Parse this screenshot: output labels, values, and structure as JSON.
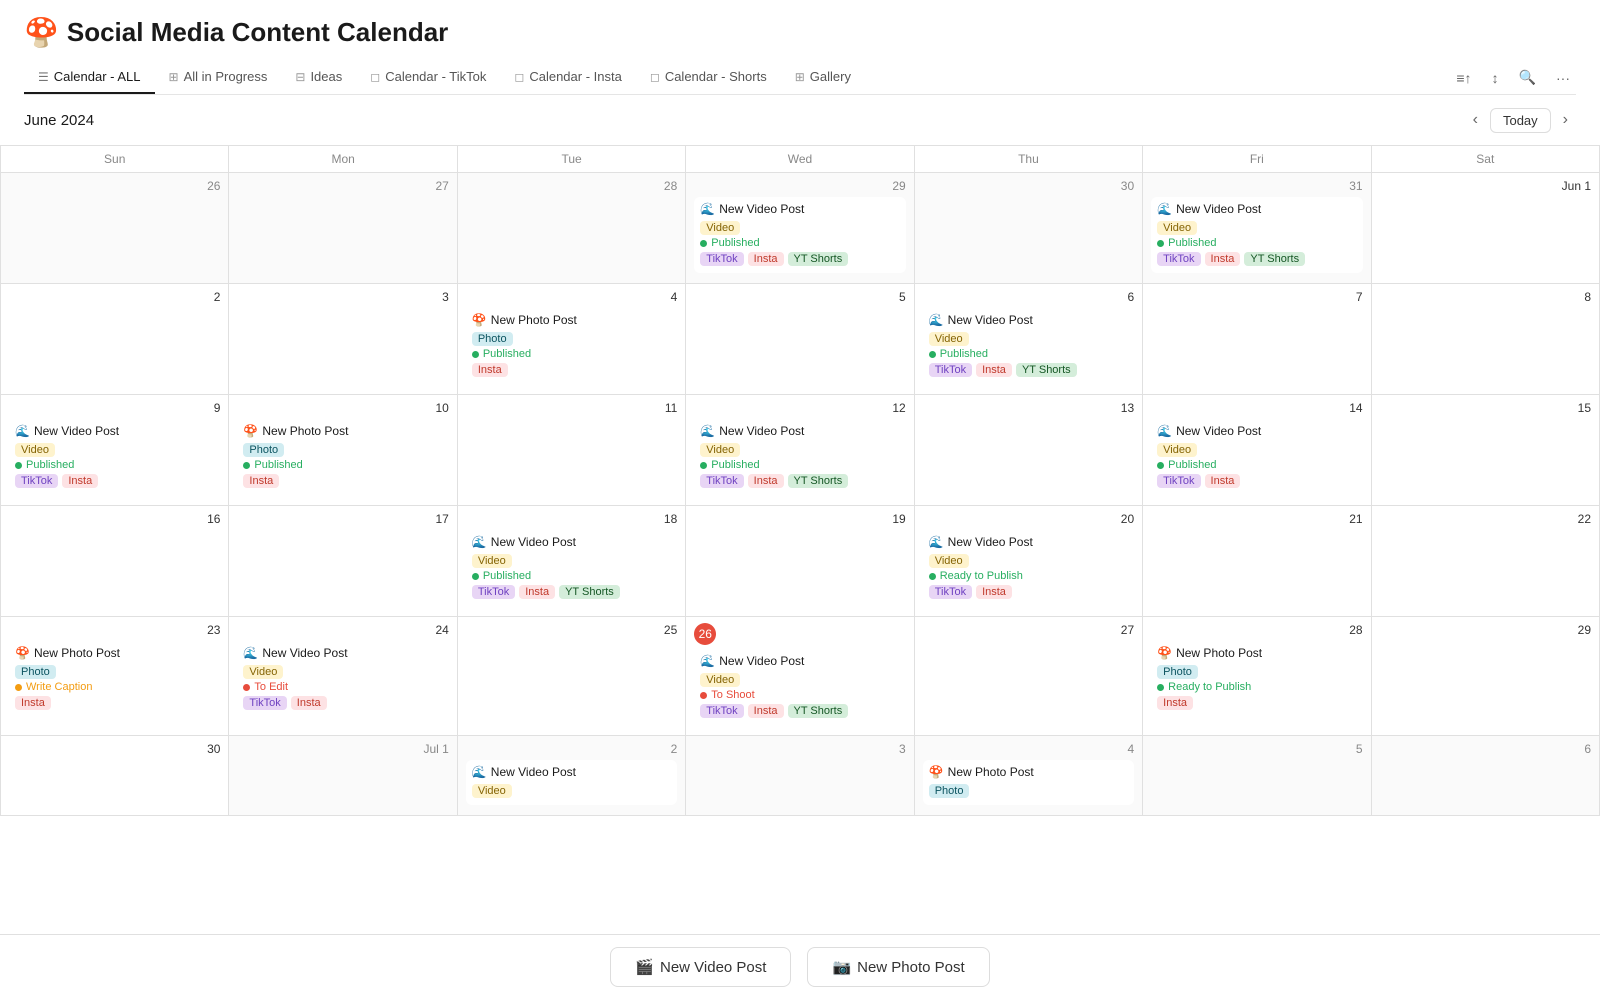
{
  "app": {
    "title": "Social Media Content Calendar",
    "emoji": "🍄"
  },
  "nav": {
    "tabs": [
      {
        "id": "calendar-all",
        "label": "Calendar - ALL",
        "icon": "☰",
        "active": true
      },
      {
        "id": "all-in-progress",
        "label": "All in Progress",
        "icon": "⊞",
        "active": false
      },
      {
        "id": "ideas",
        "label": "Ideas",
        "icon": "⊟",
        "active": false
      },
      {
        "id": "calendar-tiktok",
        "label": "Calendar - TikTok",
        "icon": "◻",
        "active": false
      },
      {
        "id": "calendar-insta",
        "label": "Calendar - Insta",
        "icon": "◻",
        "active": false
      },
      {
        "id": "calendar-shorts",
        "label": "Calendar - Shorts",
        "icon": "◻",
        "active": false
      },
      {
        "id": "gallery",
        "label": "Gallery",
        "icon": "⊞",
        "active": false
      }
    ]
  },
  "calendar": {
    "month": "June 2024",
    "today_label": "Today",
    "day_headers": [
      "Sun",
      "Mon",
      "Tue",
      "Wed",
      "Thu",
      "Fri",
      "Sat"
    ],
    "weeks": [
      {
        "days": [
          {
            "date": 26,
            "current": false,
            "today": false,
            "events": []
          },
          {
            "date": 27,
            "current": false,
            "today": false,
            "events": []
          },
          {
            "date": 28,
            "current": false,
            "today": false,
            "events": []
          },
          {
            "date": 29,
            "current": false,
            "today": false,
            "events": [
              {
                "title": "New Video Post",
                "emoji": "🌊",
                "type": "Video",
                "type_tag": "video",
                "status": "Published",
                "status_key": "published",
                "platforms": [
                  "TikTok",
                  "Insta",
                  "YT Shorts"
                ]
              }
            ]
          },
          {
            "date": 30,
            "current": false,
            "today": false,
            "events": []
          },
          {
            "date": 31,
            "current": false,
            "today": false,
            "events": [
              {
                "title": "New Video Post",
                "emoji": "🌊",
                "type": "Video",
                "type_tag": "video",
                "status": "Published",
                "status_key": "published",
                "platforms": [
                  "TikTok",
                  "Insta",
                  "YT Shorts"
                ]
              }
            ]
          },
          {
            "date": "Jun 1",
            "current": true,
            "today": false,
            "events": []
          }
        ]
      },
      {
        "days": [
          {
            "date": 2,
            "current": true,
            "today": false,
            "events": []
          },
          {
            "date": 3,
            "current": true,
            "today": false,
            "events": []
          },
          {
            "date": 4,
            "current": true,
            "today": false,
            "events": [
              {
                "title": "New Photo Post",
                "emoji": "🍄",
                "type": "Photo",
                "type_tag": "photo",
                "status": "Published",
                "status_key": "published",
                "platforms": [
                  "Insta"
                ]
              }
            ]
          },
          {
            "date": 5,
            "current": true,
            "today": false,
            "events": []
          },
          {
            "date": 6,
            "current": true,
            "today": false,
            "events": [
              {
                "title": "New Video Post",
                "emoji": "🌊",
                "type": "Video",
                "type_tag": "video",
                "status": "Published",
                "status_key": "published",
                "platforms": [
                  "TikTok",
                  "Insta",
                  "YT Shorts"
                ]
              }
            ]
          },
          {
            "date": 7,
            "current": true,
            "today": false,
            "events": []
          },
          {
            "date": 8,
            "current": true,
            "today": false,
            "events": []
          }
        ]
      },
      {
        "days": [
          {
            "date": 9,
            "current": true,
            "today": false,
            "events": [
              {
                "title": "New Video Post",
                "emoji": "🌊",
                "type": "Video",
                "type_tag": "video",
                "status": "Published",
                "status_key": "published",
                "platforms": [
                  "TikTok",
                  "Insta"
                ]
              }
            ]
          },
          {
            "date": 10,
            "current": true,
            "today": false,
            "events": [
              {
                "title": "New Photo Post",
                "emoji": "🍄",
                "type": "Photo",
                "type_tag": "photo",
                "status": "Published",
                "status_key": "published",
                "platforms": [
                  "Insta"
                ]
              }
            ]
          },
          {
            "date": 11,
            "current": true,
            "today": false,
            "events": []
          },
          {
            "date": 12,
            "current": true,
            "today": false,
            "events": [
              {
                "title": "New Video Post",
                "emoji": "🌊",
                "type": "Video",
                "type_tag": "video",
                "status": "Published",
                "status_key": "published",
                "platforms": [
                  "TikTok",
                  "Insta",
                  "YT Shorts"
                ]
              }
            ]
          },
          {
            "date": 13,
            "current": true,
            "today": false,
            "events": []
          },
          {
            "date": 14,
            "current": true,
            "today": false,
            "events": [
              {
                "title": "New Video Post",
                "emoji": "🌊",
                "type": "Video",
                "type_tag": "video",
                "status": "Published",
                "status_key": "published",
                "platforms": [
                  "TikTok",
                  "Insta"
                ]
              }
            ]
          },
          {
            "date": 15,
            "current": true,
            "today": false,
            "events": []
          }
        ]
      },
      {
        "days": [
          {
            "date": 16,
            "current": true,
            "today": false,
            "events": []
          },
          {
            "date": 17,
            "current": true,
            "today": false,
            "events": []
          },
          {
            "date": 18,
            "current": true,
            "today": false,
            "events": [
              {
                "title": "New Video Post",
                "emoji": "🌊",
                "type": "Video",
                "type_tag": "video",
                "status": "Published",
                "status_key": "published",
                "platforms": [
                  "TikTok",
                  "Insta",
                  "YT Shorts"
                ]
              }
            ]
          },
          {
            "date": 19,
            "current": true,
            "today": false,
            "events": []
          },
          {
            "date": 20,
            "current": true,
            "today": false,
            "events": [
              {
                "title": "New Video Post",
                "emoji": "🌊",
                "type": "Video",
                "type_tag": "video",
                "status": "Ready to Publish",
                "status_key": "ready",
                "platforms": [
                  "TikTok",
                  "Insta"
                ]
              }
            ]
          },
          {
            "date": 21,
            "current": true,
            "today": false,
            "events": []
          },
          {
            "date": 22,
            "current": true,
            "today": false,
            "events": []
          }
        ]
      },
      {
        "days": [
          {
            "date": 23,
            "current": true,
            "today": false,
            "events": [
              {
                "title": "New Photo Post",
                "emoji": "🍄",
                "type": "Photo",
                "type_tag": "photo",
                "status": "Write Caption",
                "status_key": "write-caption",
                "platforms": [
                  "Insta"
                ]
              }
            ]
          },
          {
            "date": 24,
            "current": true,
            "today": false,
            "events": [
              {
                "title": "New Video Post",
                "emoji": "🌊",
                "type": "Video",
                "type_tag": "video",
                "status": "To Edit",
                "status_key": "to-edit",
                "platforms": [
                  "TikTok",
                  "Insta"
                ]
              }
            ]
          },
          {
            "date": 25,
            "current": true,
            "today": false,
            "events": []
          },
          {
            "date": 26,
            "current": true,
            "today": true,
            "events": [
              {
                "title": "New Video Post",
                "emoji": "🌊",
                "type": "Video",
                "type_tag": "video",
                "status": "To Shoot",
                "status_key": "to-shoot",
                "platforms": [
                  "TikTok",
                  "Insta",
                  "YT Shorts"
                ]
              }
            ]
          },
          {
            "date": 27,
            "current": true,
            "today": false,
            "events": []
          },
          {
            "date": 28,
            "current": true,
            "today": false,
            "events": [
              {
                "title": "New Photo Post",
                "emoji": "🍄",
                "type": "Photo",
                "type_tag": "photo",
                "status": "Ready to Publish",
                "status_key": "ready",
                "platforms": [
                  "Insta"
                ]
              }
            ]
          },
          {
            "date": 29,
            "current": true,
            "today": false,
            "events": []
          }
        ]
      },
      {
        "days": [
          {
            "date": 30,
            "current": true,
            "today": false,
            "events": []
          },
          {
            "date": "Jul 1",
            "current": false,
            "today": false,
            "events": []
          },
          {
            "date": 2,
            "current": false,
            "today": false,
            "events": [
              {
                "title": "New Video Post",
                "emoji": "🌊",
                "type": "Video",
                "type_tag": "video",
                "status": "",
                "status_key": "",
                "platforms": []
              }
            ]
          },
          {
            "date": 3,
            "current": false,
            "today": false,
            "events": []
          },
          {
            "date": 4,
            "current": false,
            "today": false,
            "events": [
              {
                "title": "New Photo Post",
                "emoji": "🍄",
                "type": "Photo",
                "type_tag": "photo",
                "status": "",
                "status_key": "",
                "platforms": []
              }
            ]
          },
          {
            "date": 5,
            "current": false,
            "today": false,
            "events": []
          },
          {
            "date": 6,
            "current": false,
            "today": false,
            "events": []
          }
        ]
      }
    ]
  },
  "bottom_bar": {
    "new_video_post": "New Video Post",
    "new_photo_post": "New Photo Post"
  }
}
